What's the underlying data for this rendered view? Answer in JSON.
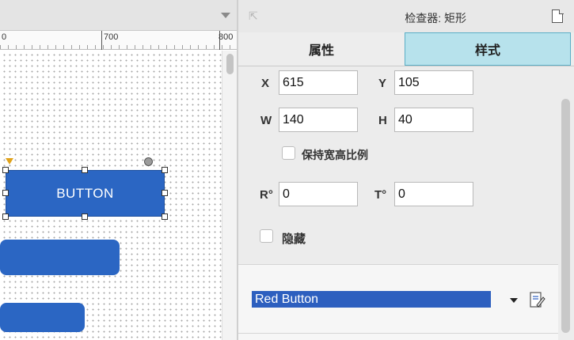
{
  "ruler": {
    "labels": [
      "0",
      "700",
      "800"
    ]
  },
  "canvas": {
    "button_label": "BUTTON"
  },
  "inspector": {
    "title": "检查器: 矩形",
    "tabs": {
      "properties": "属性",
      "style": "样式"
    },
    "fields": {
      "x_label": "X",
      "x_value": "615",
      "y_label": "Y",
      "y_value": "105",
      "w_label": "W",
      "w_value": "140",
      "h_label": "H",
      "h_value": "40",
      "r_label": "R°",
      "r_value": "0",
      "t_label": "T°",
      "t_value": "0"
    },
    "keep_ratio_label": "保持宽高比例",
    "hidden_label": "隐藏",
    "style_select": {
      "selected": "Red Button"
    }
  },
  "colors": {
    "shape_fill": "#2b66c3",
    "active_tab": "#b7e2ec",
    "selection": "#2d5fbf"
  },
  "icons": [
    "chevron-down-icon",
    "collapse-arrow-icon",
    "page-icon",
    "edit-style-icon",
    "rotate-handle-icon",
    "anchor-marker-icon"
  ]
}
